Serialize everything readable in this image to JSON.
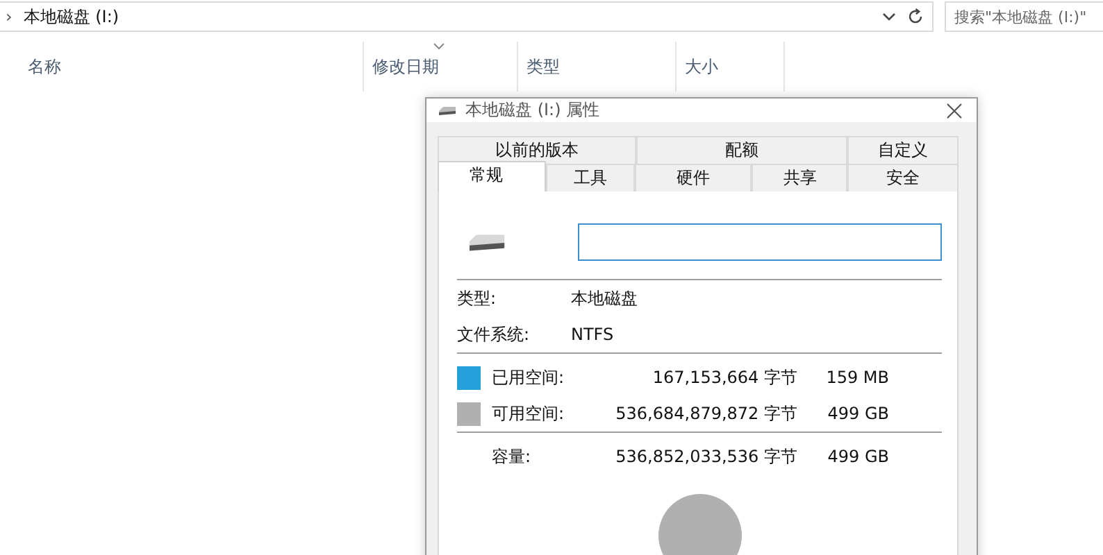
{
  "address_bar": {
    "separator": "›",
    "path": "本地磁盘 (I:)"
  },
  "search": {
    "placeholder": "搜索\"本地磁盘 (I:)\""
  },
  "columns": [
    {
      "label": "名称",
      "sorted": false
    },
    {
      "label": "修改日期",
      "sorted": true
    },
    {
      "label": "类型",
      "sorted": false
    },
    {
      "label": "大小",
      "sorted": false
    }
  ],
  "dialog": {
    "title": "本地磁盘 (I:) 属性",
    "tab_rows": [
      [
        {
          "label": "以前的版本",
          "selected": false
        },
        {
          "label": "配额",
          "selected": false
        },
        {
          "label": "自定义",
          "selected": false
        }
      ],
      [
        {
          "label": "常规",
          "selected": true
        },
        {
          "label": "工具",
          "selected": false
        },
        {
          "label": "硬件",
          "selected": false
        },
        {
          "label": "共享",
          "selected": false
        },
        {
          "label": "安全",
          "selected": false
        }
      ]
    ],
    "info": [
      {
        "label": "类型:",
        "value": "本地磁盘"
      },
      {
        "label": "文件系统:",
        "value": "NTFS"
      }
    ],
    "space": [
      {
        "label": "已用空间:",
        "bytes": "167,153,664 字节",
        "size": "159 MB",
        "color": "#26a0da"
      },
      {
        "label": "可用空间:",
        "bytes": "536,684,879,872 字节",
        "size": "499 GB",
        "color": "#b0b0b0"
      }
    ],
    "capacity": {
      "label": "容量:",
      "bytes": "536,852,033,536 字节",
      "size": "499 GB"
    }
  }
}
